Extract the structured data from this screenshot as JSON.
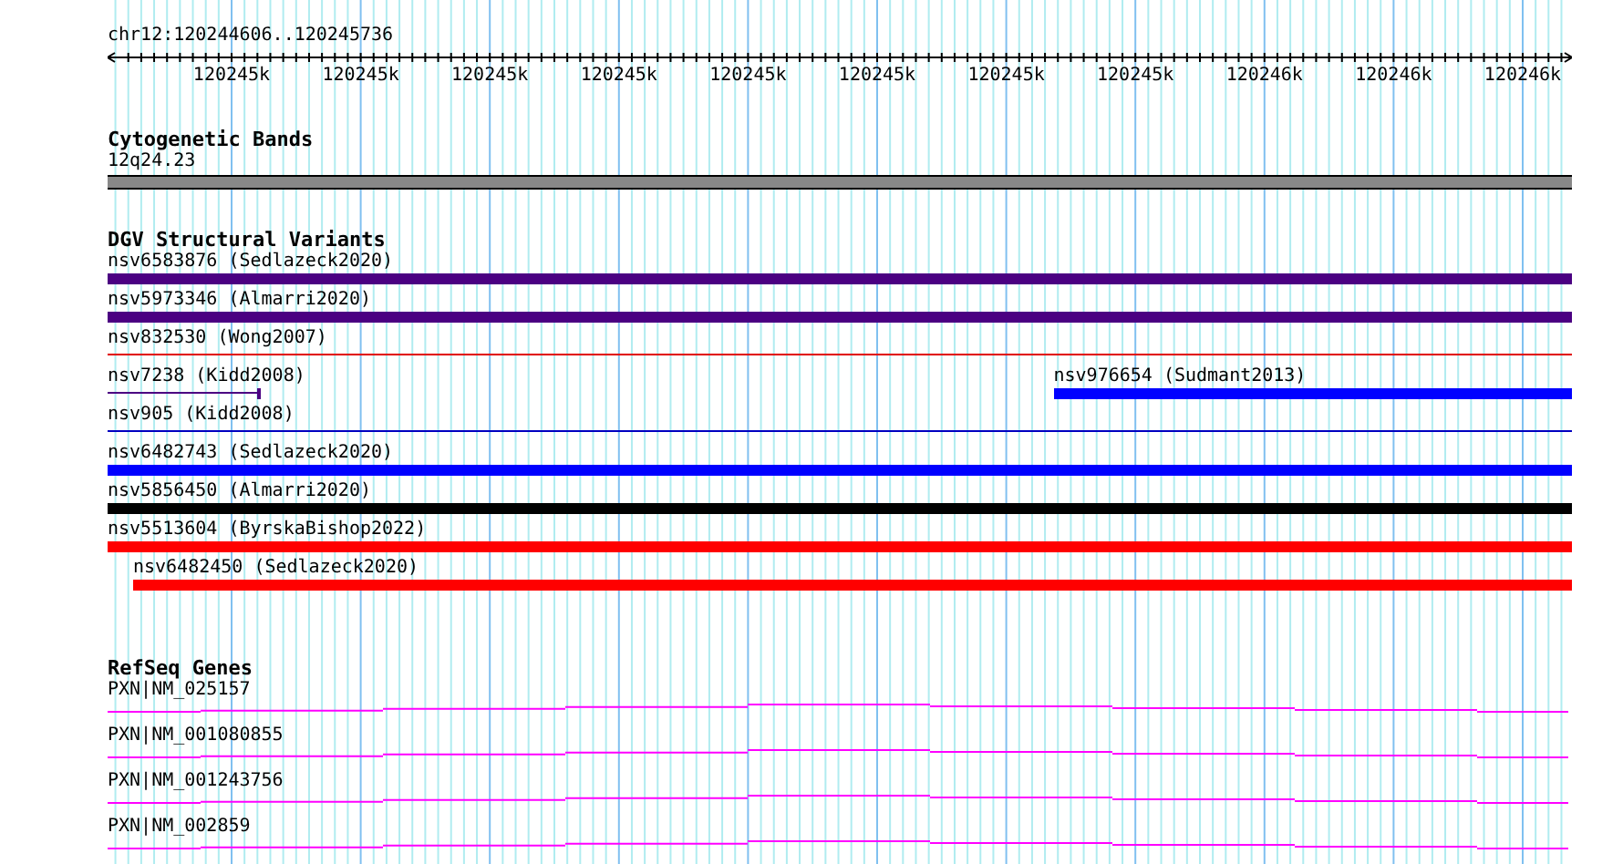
{
  "position": "chr12:120244606..120245736",
  "ruler": {
    "tick_labels": [
      "120245k",
      "120245k",
      "120245k",
      "120245k",
      "120245k",
      "120245k",
      "120245k",
      "120245k",
      "120246k",
      "120246k",
      "120246k"
    ]
  },
  "cytogenetic_bands": {
    "title": "Cytogenetic Bands",
    "band": "12q24.23"
  },
  "dgv": {
    "title": "DGV Structural Variants",
    "rows": [
      {
        "features": [
          {
            "label": "nsv6583876 (Sedlazeck2020)",
            "color": "#4b0082",
            "kind": "bar"
          }
        ]
      },
      {
        "features": [
          {
            "label": "nsv5973346 (Almarri2020)",
            "color": "#4b0082",
            "kind": "bar"
          }
        ]
      },
      {
        "features": [
          {
            "label": "nsv832530 (Wong2007)",
            "color": "#e00000",
            "kind": "line"
          }
        ]
      },
      {
        "features": [
          {
            "label": "nsv7238 (Kidd2008)",
            "color": "#4b0082",
            "kind": "stub"
          },
          {
            "label": "nsv976654 (Sudmant2013)",
            "color": "#0000ff",
            "kind": "tail"
          }
        ]
      },
      {
        "features": [
          {
            "label": "nsv905 (Kidd2008)",
            "color": "#0000c0",
            "kind": "line"
          }
        ]
      },
      {
        "features": [
          {
            "label": "nsv6482743 (Sedlazeck2020)",
            "color": "#0000ff",
            "kind": "bar"
          }
        ]
      },
      {
        "features": [
          {
            "label": "nsv5856450 (Almarri2020)",
            "color": "#000000",
            "kind": "bar"
          }
        ]
      },
      {
        "features": [
          {
            "label": "nsv5513604 (ByrskaBishop2022)",
            "color": "#ff0000",
            "kind": "bar"
          }
        ]
      },
      {
        "features": [
          {
            "label": "nsv6482450 (Sedlazeck2020)",
            "color": "#ff0000",
            "kind": "inset"
          }
        ]
      }
    ]
  },
  "refseq": {
    "title": "RefSeq Genes",
    "genes": [
      "PXN|NM_025157",
      "PXN|NM_001080855",
      "PXN|NM_001243756",
      "PXN|NM_002859"
    ]
  }
}
